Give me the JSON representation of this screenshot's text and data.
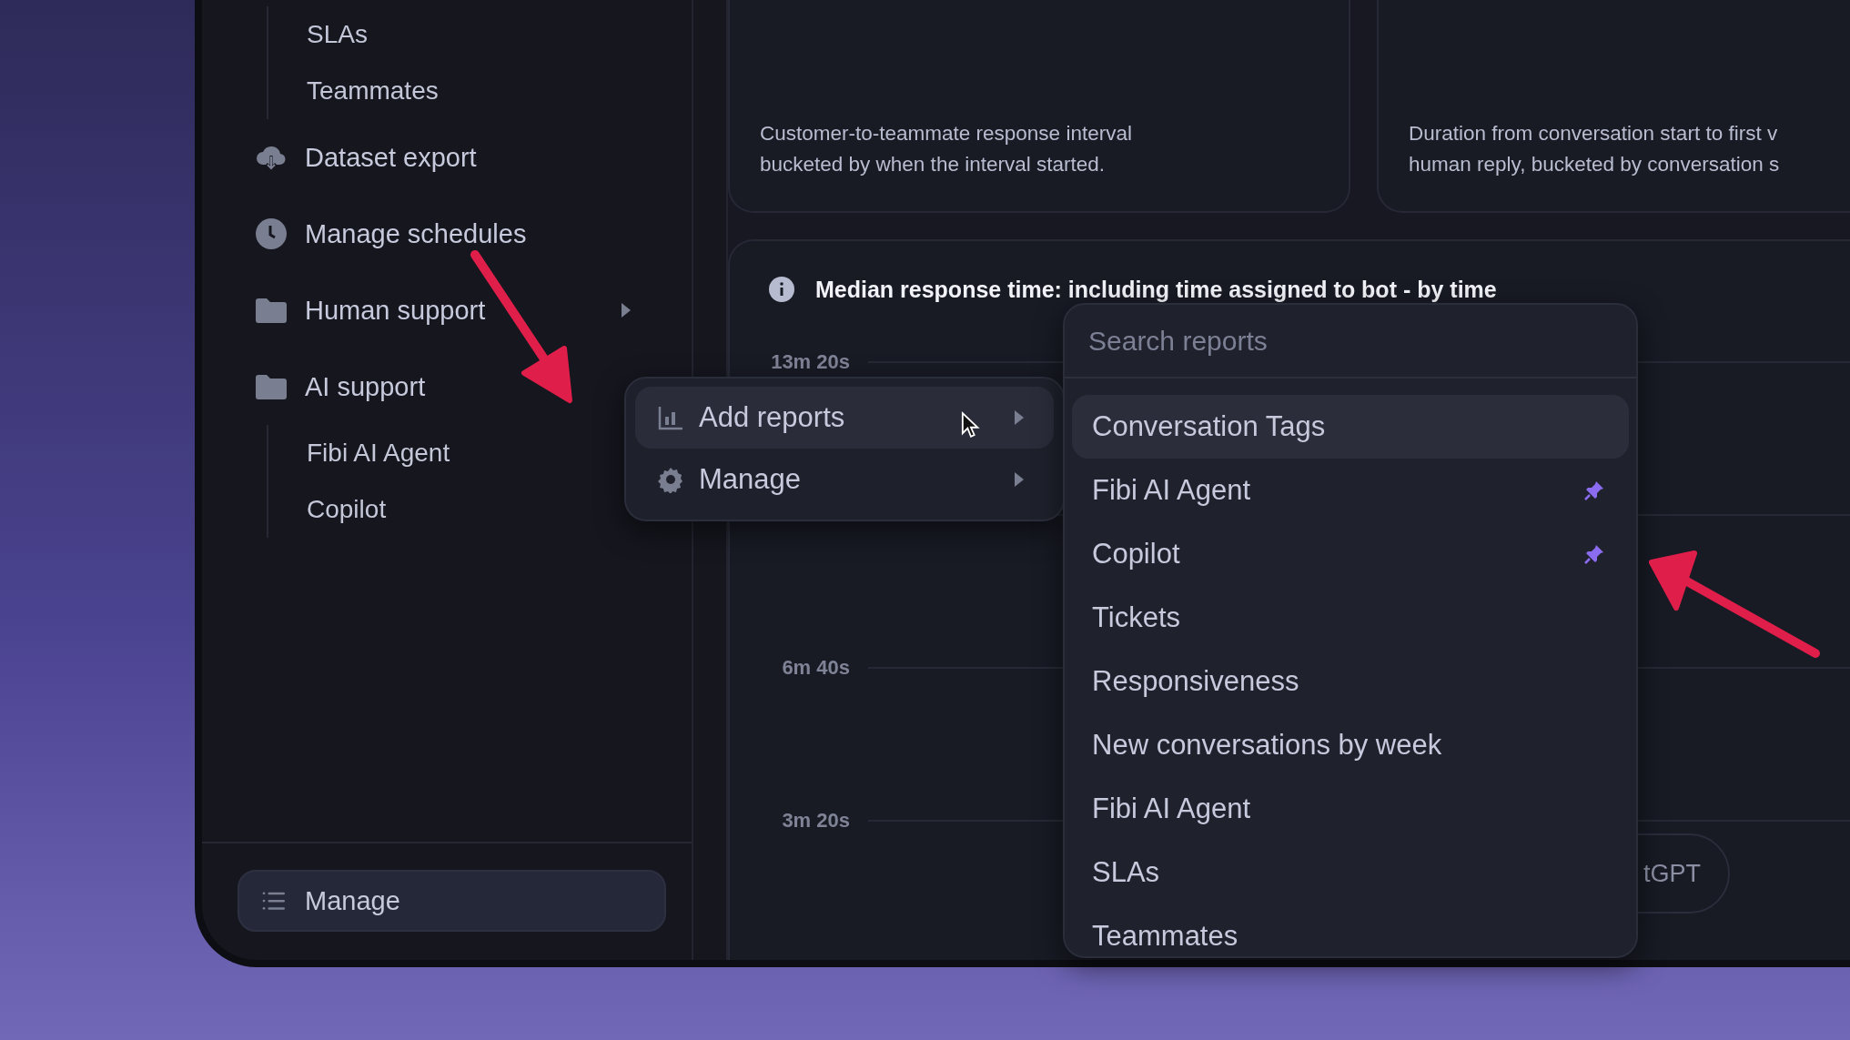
{
  "sidebar": {
    "nested_items": [
      {
        "label": "SLAs"
      },
      {
        "label": "Teammates"
      }
    ],
    "items": [
      {
        "label": "Dataset export",
        "kind": "export"
      },
      {
        "label": "Manage schedules",
        "kind": "schedule"
      },
      {
        "label": "Human support",
        "kind": "folder",
        "expanded": false
      },
      {
        "label": "AI support",
        "kind": "folder",
        "expanded": true,
        "children": [
          {
            "label": "Fibi AI Agent"
          },
          {
            "label": "Copilot"
          }
        ]
      }
    ],
    "manage_button": {
      "label": "Manage"
    }
  },
  "cards": [
    {
      "description_lines": [
        "Customer-to-teammate response interval",
        "bucketed by when the interval started."
      ]
    },
    {
      "description_lines": [
        "Duration from conversation start to first v",
        "human reply, bucketed by conversation s"
      ]
    }
  ],
  "chart_panel": {
    "title": "Median response time: including time assigned to bot - by time",
    "gridlines": [
      {
        "label": "13m 20s"
      },
      {
        "covered": true
      },
      {
        "label": "6m 40s"
      },
      {
        "label": "3m 20s"
      }
    ],
    "partial_button": "tGPT"
  },
  "context_menu": {
    "items": [
      {
        "label": "Add reports",
        "kind": "reports",
        "selected": true
      },
      {
        "label": "Manage",
        "kind": "settings",
        "selected": false
      }
    ]
  },
  "reports_menu": {
    "placeholder": "Search reports",
    "items": [
      {
        "label": "Conversation Tags",
        "selected": true,
        "pinned": false
      },
      {
        "label": "Fibi AI Agent",
        "selected": false,
        "pinned": true
      },
      {
        "label": "Copilot",
        "selected": false,
        "pinned": true
      },
      {
        "label": "Tickets",
        "selected": false,
        "pinned": false
      },
      {
        "label": "Responsiveness",
        "selected": false,
        "pinned": false
      },
      {
        "label": "New conversations by week",
        "selected": false,
        "pinned": false
      },
      {
        "label": "Fibi AI Agent",
        "selected": false,
        "pinned": false
      },
      {
        "label": "SLAs",
        "selected": false,
        "pinned": false
      },
      {
        "label": "Teammates",
        "selected": false,
        "pinned": false
      }
    ]
  }
}
